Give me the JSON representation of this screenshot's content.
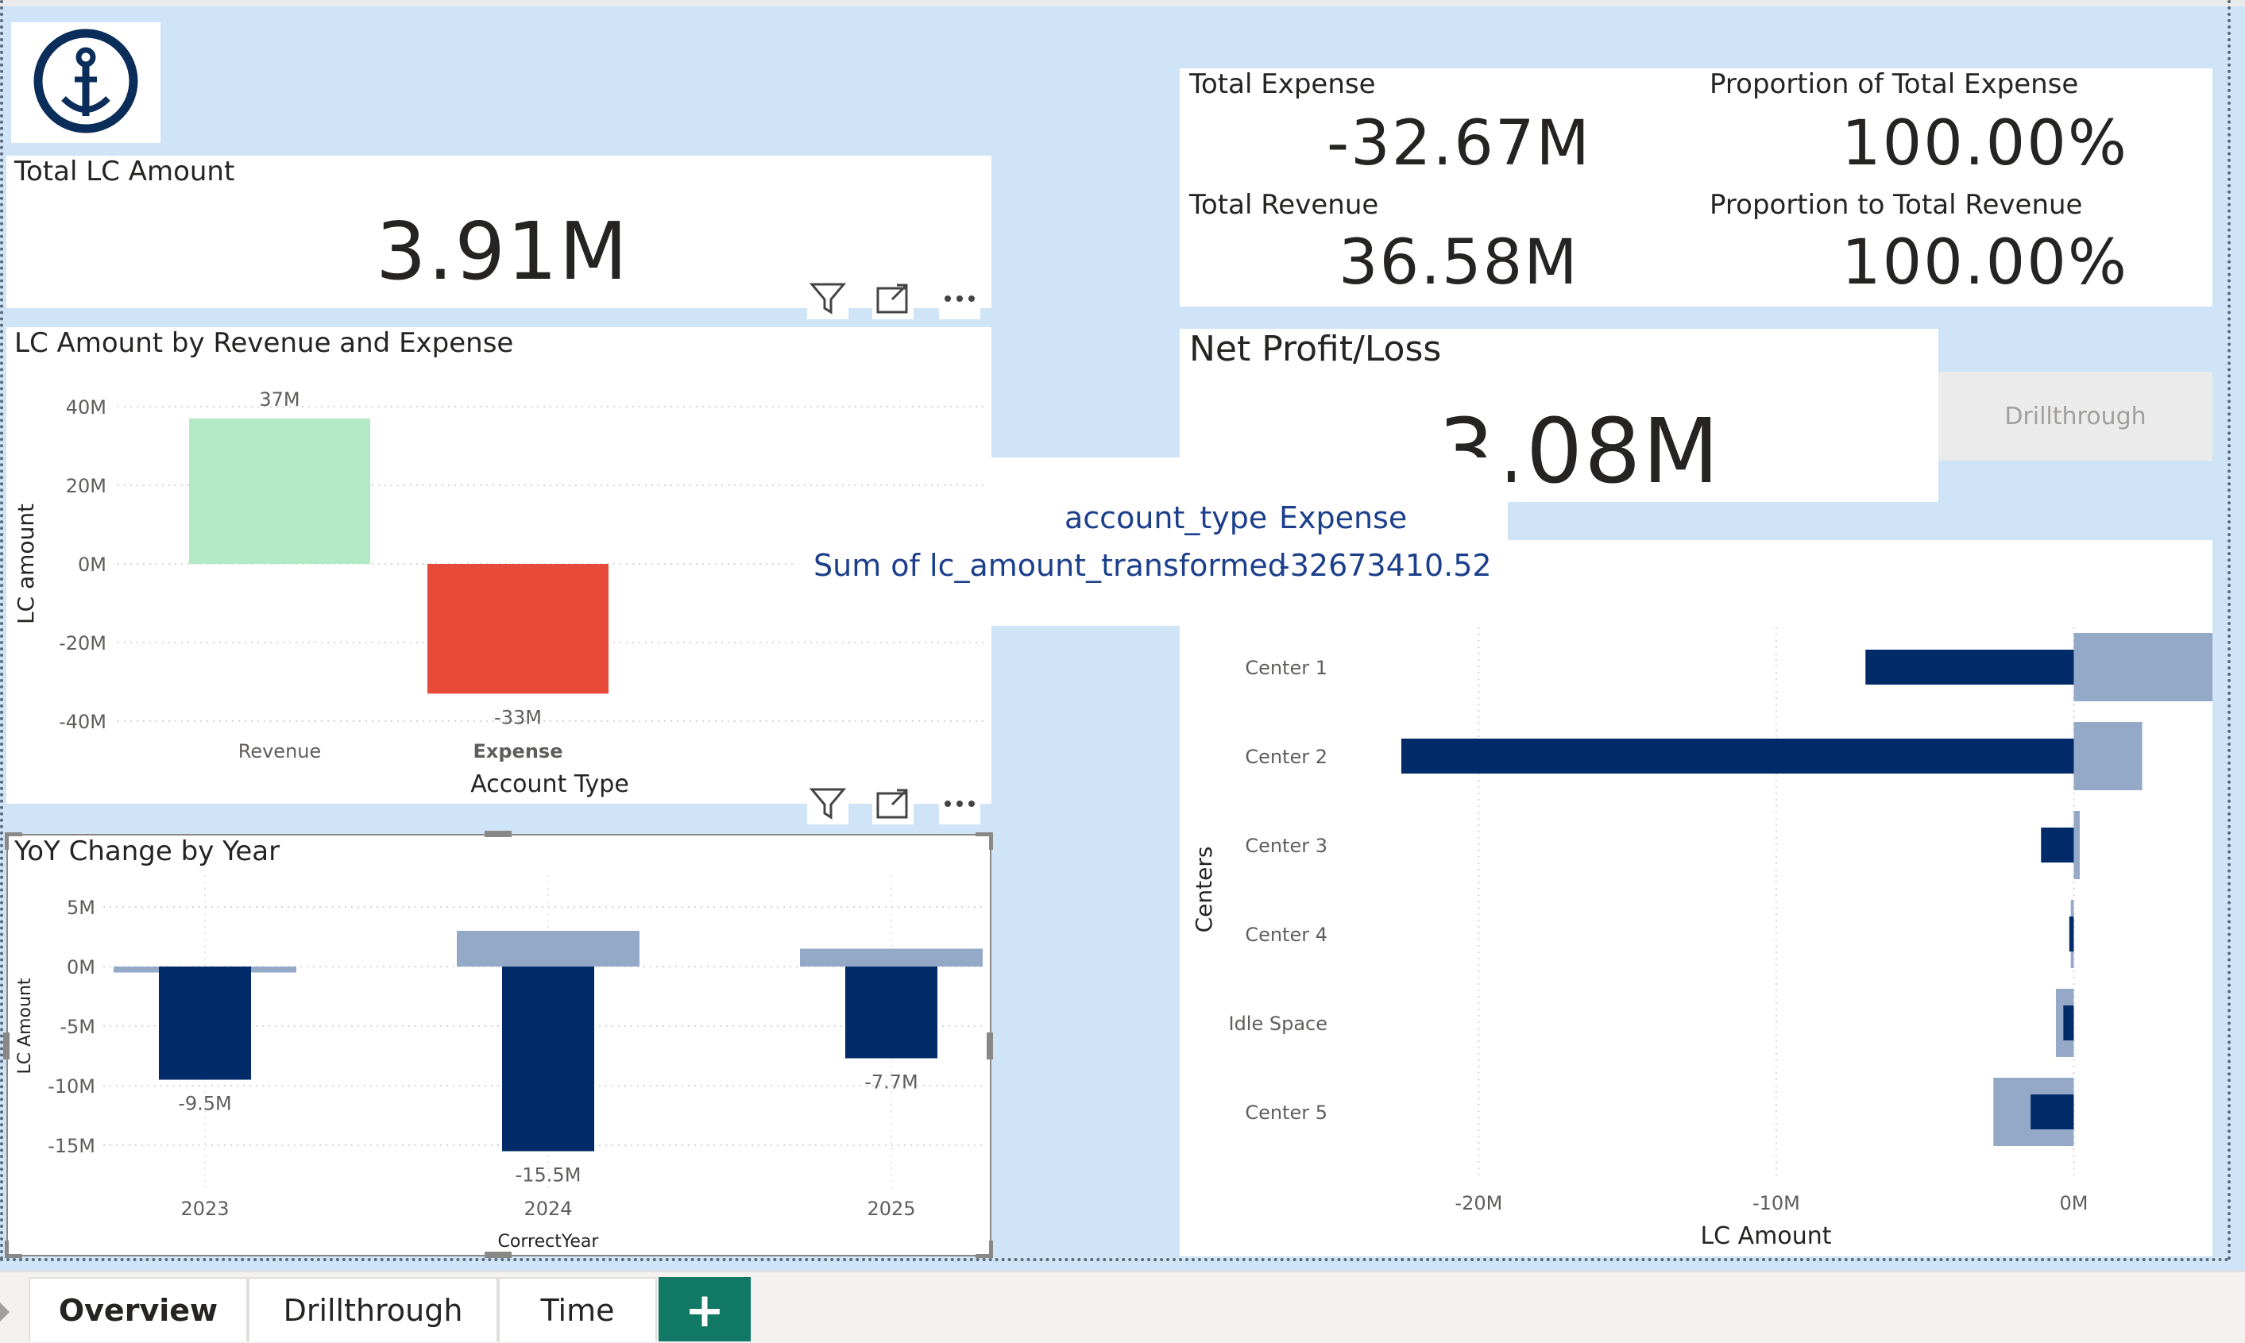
{
  "logo": {
    "icon": "anchor-icon",
    "color": "#0a2d5a"
  },
  "total_lc": {
    "title": "Total LC Amount",
    "value": "3.91M"
  },
  "kpis": {
    "total_expense": {
      "title": "Total Expense",
      "value": "-32.67M"
    },
    "proportion_expense": {
      "title": "Proportion of Total Expense",
      "value": "100.00%"
    },
    "total_revenue": {
      "title": "Total Revenue",
      "value": "36.58M"
    },
    "proportion_revenue": {
      "title": "Proportion to Total Revenue",
      "value": "100.00%"
    }
  },
  "net_profit": {
    "title": "Net Profit/Loss",
    "value": "3.08M"
  },
  "drillthrough_button": {
    "label": "Drillthrough"
  },
  "tooltip": {
    "row1_label": "account_type",
    "row1_value": "Expense",
    "row2_label": "Sum of lc_amount_transformed",
    "row2_value": "-32673410.52"
  },
  "visual_header": {
    "icons": [
      "filter-icon",
      "focus-mode-icon",
      "more-options-icon"
    ]
  },
  "tabs": [
    {
      "label": "Overview",
      "active": true
    },
    {
      "label": "Drillthrough",
      "active": false
    },
    {
      "label": "Time",
      "active": false
    }
  ],
  "add_tab": {
    "label": "+"
  },
  "chart_data": [
    {
      "type": "bar",
      "title": "LC Amount by Revenue and Expense",
      "xlabel": "Account Type",
      "ylabel": "LC amount",
      "categories": [
        "Revenue",
        "Expense"
      ],
      "values": [
        37,
        -33
      ],
      "data_labels": [
        "37M",
        "-33M"
      ],
      "colors": [
        "#b3eac5",
        "#e84a3a"
      ],
      "yticks": [
        "40M",
        "20M",
        "0M",
        "-20M",
        "-40M"
      ],
      "ylim": [
        -40,
        40
      ],
      "grid": true
    },
    {
      "type": "bar",
      "title": "YoY Change by Year",
      "xlabel": "CorrectYear",
      "ylabel": "LC Amount",
      "categories": [
        "2023",
        "2024",
        "2025"
      ],
      "series": [
        {
          "values": [
            -0.5,
            3.0,
            1.5
          ],
          "color": "#94a8c8"
        },
        {
          "values": [
            -9.5,
            -15.5,
            -7.7
          ],
          "color": "#012a69"
        }
      ],
      "data_labels": [
        "-9.5M",
        "-15.5M",
        "-7.7M"
      ],
      "yticks": [
        "5M",
        "0M",
        "-5M",
        "-10M",
        "-15M"
      ],
      "ylim": [
        -15,
        5
      ],
      "grid": true
    },
    {
      "type": "bar",
      "orientation": "horizontal",
      "xlabel": "LC Amount",
      "ylabel": "Centers",
      "categories": [
        "Center 1",
        "Center 2",
        "Center 3",
        "Center 4",
        "Idle Space",
        "Center 5"
      ],
      "series": [
        {
          "values": [
            8.6,
            2.3,
            0.2,
            -0.1,
            -0.6,
            -2.7
          ],
          "color": "#94a8c8"
        },
        {
          "values": [
            -7.0,
            -22.6,
            -1.1,
            -0.15,
            -0.35,
            -1.45
          ],
          "color": "#012a69"
        }
      ],
      "xticks": [
        "-20M",
        "-10M",
        "0M"
      ],
      "xlim": [
        -23,
        4.5
      ],
      "grid": true
    }
  ]
}
